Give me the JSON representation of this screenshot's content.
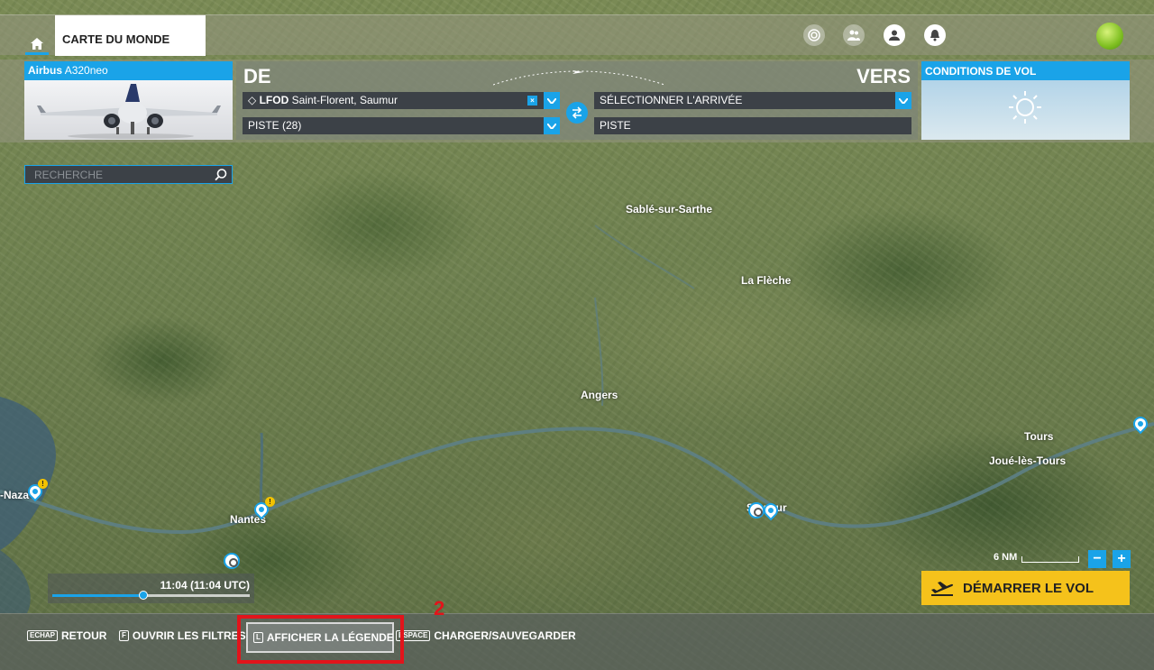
{
  "topbar": {
    "tab_label": "CARTE DU MONDE",
    "icons": [
      "home-icon",
      "activity-icon",
      "multiplayer-icon",
      "profile-icon",
      "notification-icon"
    ]
  },
  "aircraft": {
    "brand": "Airbus",
    "model": "A320neo"
  },
  "route": {
    "from_title": "DE",
    "to_title": "VERS",
    "departure_code": "LFOD",
    "departure_name": "Saint-Florent, Saumur",
    "departure_runway": "PISTE (28)",
    "arrival_placeholder": "SÉLECTIONNER L'ARRIVÉE",
    "arrival_runway": "PISTE"
  },
  "weather": {
    "title": "CONDITIONS DE VOL",
    "icon": "sun-icon"
  },
  "search": {
    "placeholder": "RECHERCHE"
  },
  "map": {
    "cities": [
      "Sablé-sur-Sarthe",
      "La Flèche",
      "Angers",
      "Tours",
      "Joué-lès-Tours",
      "Nantes",
      "-Naza",
      "Saumur"
    ]
  },
  "time": {
    "label": "11:04 (11:04 UTC)",
    "progress": 0.46
  },
  "scale": {
    "label": "6 NM"
  },
  "zoom": {
    "out": "−",
    "in": "+"
  },
  "start_flight": {
    "label": "DÉMARRER LE VOL"
  },
  "bottom_hints": {
    "back_key": "ECHAP",
    "back_label": "RETOUR",
    "filters_key": "F",
    "filters_label": "OUVRIR LES FILTRES",
    "legend_key": "L",
    "legend_label": "AFFICHER LA LÉGENDE",
    "save_key": "ESPACE",
    "save_label": "CHARGER/SAUVEGARDER"
  },
  "annotation": {
    "step": "2"
  },
  "colors": {
    "accent": "#1aa3e8",
    "start": "#f5c21b",
    "highlight": "#e2141b"
  }
}
